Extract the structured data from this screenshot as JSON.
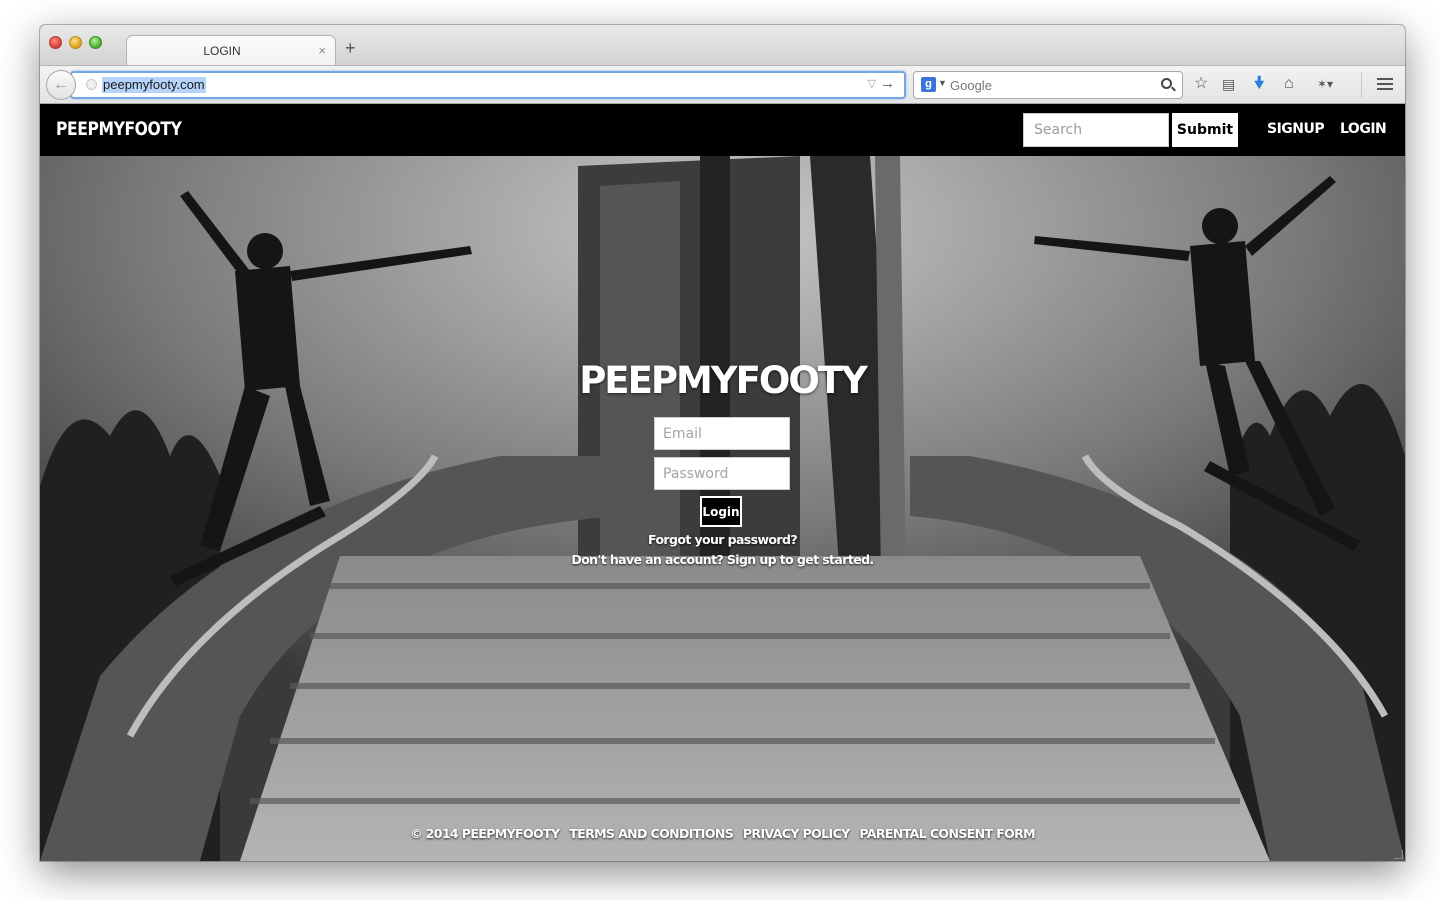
{
  "browser": {
    "tab_title": "LOGIN",
    "tab_close_glyph": "×",
    "new_tab_glyph": "+",
    "url": "peepmyfooty.com",
    "search_engine_placeholder": "Google",
    "search_engine_badge": "g"
  },
  "navbar": {
    "brand": "PEEPMYFOOTY",
    "search_placeholder": "Search",
    "submit_label": "Submit",
    "signup_label": "SIGNUP",
    "login_label": "LOGIN"
  },
  "login": {
    "title": "PEEPMYFOOTY",
    "email_placeholder": "Email",
    "password_placeholder": "Password",
    "button_label": "Login",
    "forgot_text": "Forgot your password?",
    "signup_prompt": "Don't have an account? Sign up to get started."
  },
  "footer": {
    "copyright": "© 2014 PEEPMYFOOTY",
    "terms": "TERMS AND CONDITIONS",
    "privacy": "PRIVACY POLICY",
    "consent": "PARENTAL CONSENT FORM"
  },
  "colors": {
    "navbar_bg": "#000000",
    "url_focus": "#74a7e0",
    "url_selection": "#b5d4fc",
    "download_arrow": "#2a7fe0"
  },
  "icons": [
    "back-arrow-icon",
    "globe-icon",
    "dropdown-triangle-icon",
    "go-arrow-icon",
    "search-icon",
    "star-icon",
    "reading-list-icon",
    "download-icon",
    "home-icon",
    "extension-icon",
    "menu-icon"
  ]
}
